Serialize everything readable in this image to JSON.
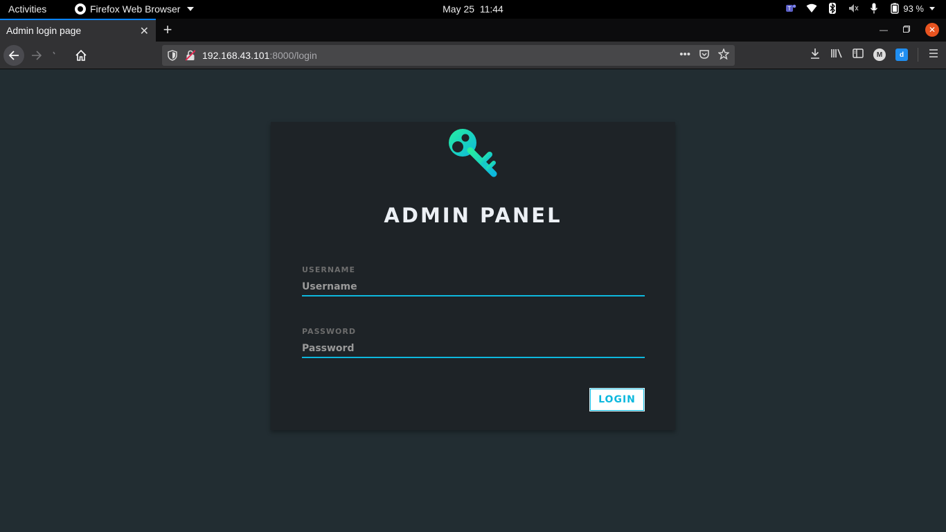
{
  "os": {
    "activities": "Activities",
    "app_name": "Firefox Web Browser",
    "date": "May 25",
    "time": "11:44",
    "battery": "93 %"
  },
  "browser": {
    "tab_title": "Admin login page",
    "url_host": "192.168.43.101",
    "url_path": ":8000/login"
  },
  "login": {
    "title": "ADMIN PANEL",
    "username_label": "USERNAME",
    "username_placeholder": "Username",
    "password_label": "PASSWORD",
    "password_placeholder": "Password",
    "button_label": "LOGIN"
  },
  "colors": {
    "accent": "#0db8de",
    "key_gradient_start": "#27ef9f",
    "key_gradient_end": "#0db8de",
    "page_bg": "#222d32",
    "card_bg": "#1e2327"
  }
}
